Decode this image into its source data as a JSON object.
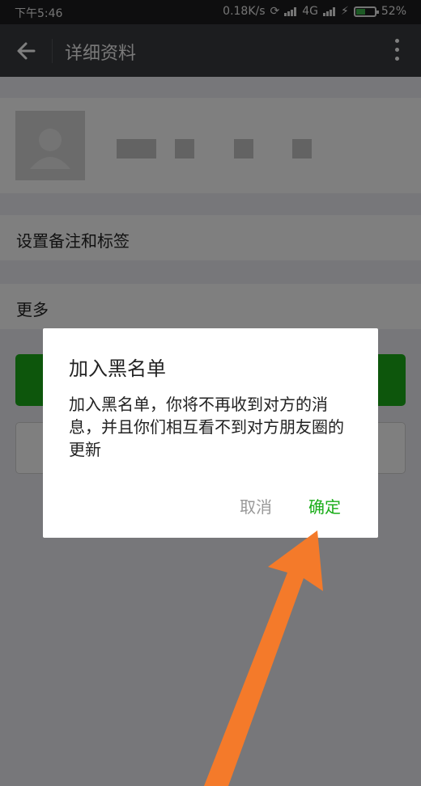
{
  "status_bar": {
    "time": "下午5:46",
    "network_speed": "0.18K/s",
    "network_type": "4G",
    "battery": "52%",
    "battery_level": 0.52
  },
  "title_bar": {
    "title": "详细资料",
    "back_icon": "back-arrow-icon",
    "more_icon": "more-vertical-icon"
  },
  "list": {
    "remark_label": "设置备注和标签",
    "more_label": "更多"
  },
  "dialog": {
    "title": "加入黑名单",
    "message": "加入黑名单，你将不再收到对方的消息，并且你们相互看不到对方朋友圈的更新",
    "cancel": "取消",
    "confirm": "确定"
  },
  "colors": {
    "accent_green": "#1aad19",
    "title_bar": "#393a3f",
    "annotation_arrow": "#f47a2a"
  }
}
